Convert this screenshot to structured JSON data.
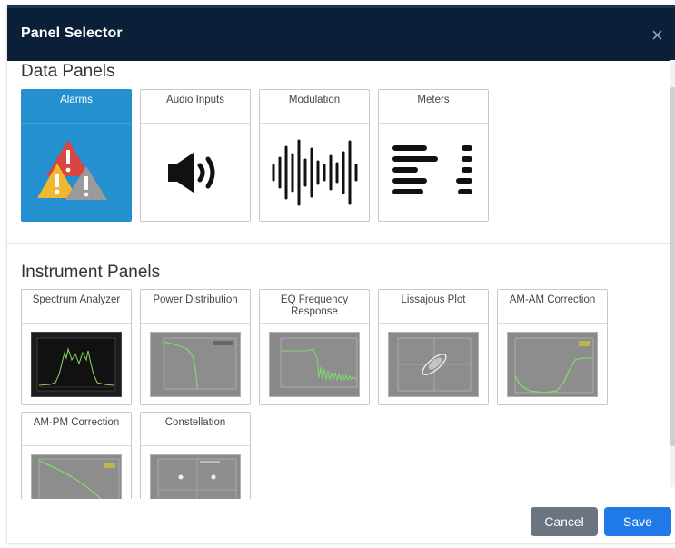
{
  "dialog": {
    "title": "Panel Selector",
    "close_symbol": "×"
  },
  "data_panels": {
    "heading": "Data Panels",
    "items": [
      {
        "label": "Alarms",
        "icon": "alarms-icon",
        "selected": true
      },
      {
        "label": "Audio Inputs",
        "icon": "speaker-icon",
        "selected": false
      },
      {
        "label": "Modulation",
        "icon": "waveform-icon",
        "selected": false
      },
      {
        "label": "Meters",
        "icon": "meters-icon",
        "selected": false
      }
    ]
  },
  "instrument_panels": {
    "heading": "Instrument Panels",
    "items": [
      {
        "label": "Spectrum Analyzer",
        "icon": "spectrum-thumbnail"
      },
      {
        "label": "Power Distribution",
        "icon": "power-distribution-thumbnail"
      },
      {
        "label": "EQ Frequency Response",
        "icon": "eq-response-thumbnail"
      },
      {
        "label": "Lissajous Plot",
        "icon": "lissajous-thumbnail"
      },
      {
        "label": "AM-AM Correction",
        "icon": "am-am-thumbnail"
      },
      {
        "label": "AM-PM Correction",
        "icon": "am-pm-thumbnail"
      },
      {
        "label": "Constellation",
        "icon": "constellation-thumbnail"
      }
    ]
  },
  "footer": {
    "cancel_label": "Cancel",
    "save_label": "Save"
  },
  "colors": {
    "header_bg": "#0b2038",
    "selected_card": "#2490d0",
    "save_button": "#1f7ae8",
    "cancel_button": "#6b7480",
    "alarm_red": "#d9453f",
    "alarm_yellow": "#f2b631",
    "alarm_gray": "#9a9a9a",
    "plot_green": "#7ddc6a"
  }
}
